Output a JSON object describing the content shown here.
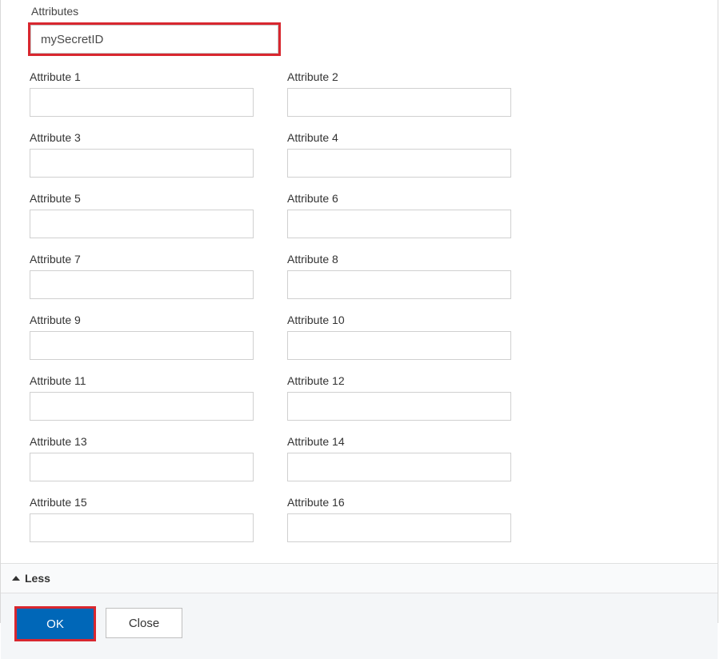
{
  "section_title": "Attributes",
  "main_value": "mySecretID",
  "attributes": [
    {
      "label": "Attribute 1",
      "value": ""
    },
    {
      "label": "Attribute 2",
      "value": ""
    },
    {
      "label": "Attribute 3",
      "value": ""
    },
    {
      "label": "Attribute 4",
      "value": ""
    },
    {
      "label": "Attribute 5",
      "value": ""
    },
    {
      "label": "Attribute 6",
      "value": ""
    },
    {
      "label": "Attribute 7",
      "value": ""
    },
    {
      "label": "Attribute 8",
      "value": ""
    },
    {
      "label": "Attribute 9",
      "value": ""
    },
    {
      "label": "Attribute 10",
      "value": ""
    },
    {
      "label": "Attribute 11",
      "value": ""
    },
    {
      "label": "Attribute 12",
      "value": ""
    },
    {
      "label": "Attribute 13",
      "value": ""
    },
    {
      "label": "Attribute 14",
      "value": ""
    },
    {
      "label": "Attribute 15",
      "value": ""
    },
    {
      "label": "Attribute 16",
      "value": ""
    }
  ],
  "toggle_label": "Less",
  "buttons": {
    "ok": "OK",
    "close": "Close"
  },
  "colors": {
    "highlight": "#d8272f",
    "primary": "#0067b8"
  }
}
